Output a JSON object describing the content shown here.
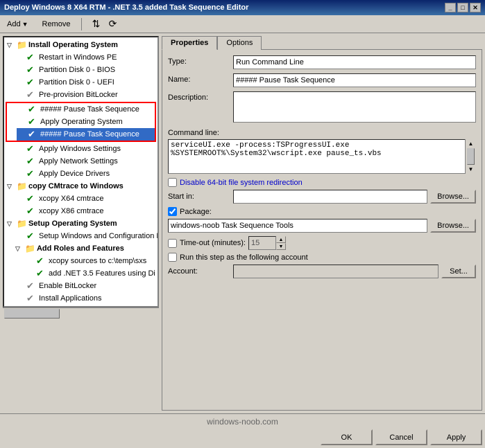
{
  "titleBar": {
    "title": "Deploy Windows 8 X64 RTM - .NET 3.5 added Task Sequence Editor",
    "controls": [
      "_",
      "□",
      "✕"
    ]
  },
  "toolbar": {
    "addLabel": "Add",
    "removeLabel": "Remove",
    "icons": [
      "↑↓",
      "⟳"
    ]
  },
  "tabs": [
    {
      "id": "properties",
      "label": "Properties"
    },
    {
      "id": "options",
      "label": "Options"
    }
  ],
  "activeTab": "properties",
  "tree": {
    "groups": [
      {
        "id": "install-os",
        "label": "Install Operating System",
        "icon": "📁",
        "children": [
          {
            "id": "restart-winpe",
            "label": "Restart in Windows PE",
            "check": "green"
          },
          {
            "id": "partition-disk0-bios",
            "label": "Partition Disk 0 - BIOS",
            "check": "green"
          },
          {
            "id": "partition-disk0-uefi",
            "label": "Partition Disk 0 - UEFI",
            "check": "green"
          },
          {
            "id": "preprovision-bitlocker",
            "label": "Pre-provision BitLocker",
            "check": "gray"
          }
        ]
      },
      {
        "id": "red-box-group",
        "children": [
          {
            "id": "pause-task-seq-1",
            "label": "##### Pause Task Sequence",
            "check": "green",
            "highlighted": false
          },
          {
            "id": "apply-os",
            "label": "Apply Operating System",
            "check": "green",
            "highlighted": false
          },
          {
            "id": "pause-task-seq-2",
            "label": "##### Pause Task Sequence",
            "check": "green",
            "highlighted": true
          }
        ]
      },
      {
        "id": "apply-windows-settings",
        "label": "Apply Windows Settings",
        "check": "green",
        "children": []
      },
      {
        "id": "apply-network-settings",
        "label": "Apply Network Settings",
        "check": "green",
        "children": []
      },
      {
        "id": "apply-device-drivers",
        "label": "Apply Device Drivers",
        "check": "green",
        "children": []
      },
      {
        "id": "copy-cmtrace",
        "label": "copy CMtrace to Windows",
        "icon": "📁",
        "children": [
          {
            "id": "xcopy-x64",
            "label": "xcopy X64 cmtrace",
            "check": "green"
          },
          {
            "id": "xcopy-x86",
            "label": "xcopy X86 cmtrace",
            "check": "green"
          }
        ]
      },
      {
        "id": "setup-os",
        "label": "Setup Operating System",
        "icon": "📁",
        "children": [
          {
            "id": "setup-windows-config",
            "label": "Setup Windows and Configuration M",
            "check": "green",
            "icon": "📁"
          },
          {
            "id": "add-roles-features",
            "label": "Add Roles and Features",
            "icon": "📁",
            "children": [
              {
                "id": "xcopy-sources",
                "label": "xcopy sources to c:\\temp\\sxs",
                "check": "green"
              },
              {
                "id": "add-net35",
                "label": "add .NET 3.5 Features using Di",
                "check": "green"
              }
            ]
          },
          {
            "id": "enable-bitlocker",
            "label": "Enable BitLocker",
            "check": "gray"
          },
          {
            "id": "install-applications",
            "label": "Install Applications",
            "check": "gray"
          }
        ]
      }
    ]
  },
  "properties": {
    "typeLabel": "Type:",
    "typeValue": "Run Command Line",
    "nameLabel": "Name:",
    "nameValue": "##### Pause Task Sequence",
    "descriptionLabel": "Description:",
    "descriptionValue": "",
    "commandLineLabel": "Command line:",
    "commandLineValue": "serviceUI.exe -process:TSProgressUI.exe %SYSTEMROOT%\\System32\\wscript.exe pause_ts.vbs",
    "disable64BitLabel": "Disable 64-bit file system redirection",
    "disable64BitChecked": false,
    "startInLabel": "Start in:",
    "startInValue": "",
    "packageLabel": "Package:",
    "packageChecked": true,
    "packageValue": "windows-noob Task Sequence Tools",
    "timeoutLabel": "Time-out (minutes):",
    "timeoutChecked": false,
    "timeoutValue": "15",
    "runAsLabel": "Run this step as the following account",
    "runAsChecked": false,
    "accountLabel": "Account:",
    "accountValue": "",
    "browseLabel": "Browse...",
    "setLabel": "Set..."
  },
  "footer": {
    "watermark": "windows-noob.com",
    "okLabel": "OK",
    "cancelLabel": "Cancel",
    "applyLabel": "Apply"
  }
}
